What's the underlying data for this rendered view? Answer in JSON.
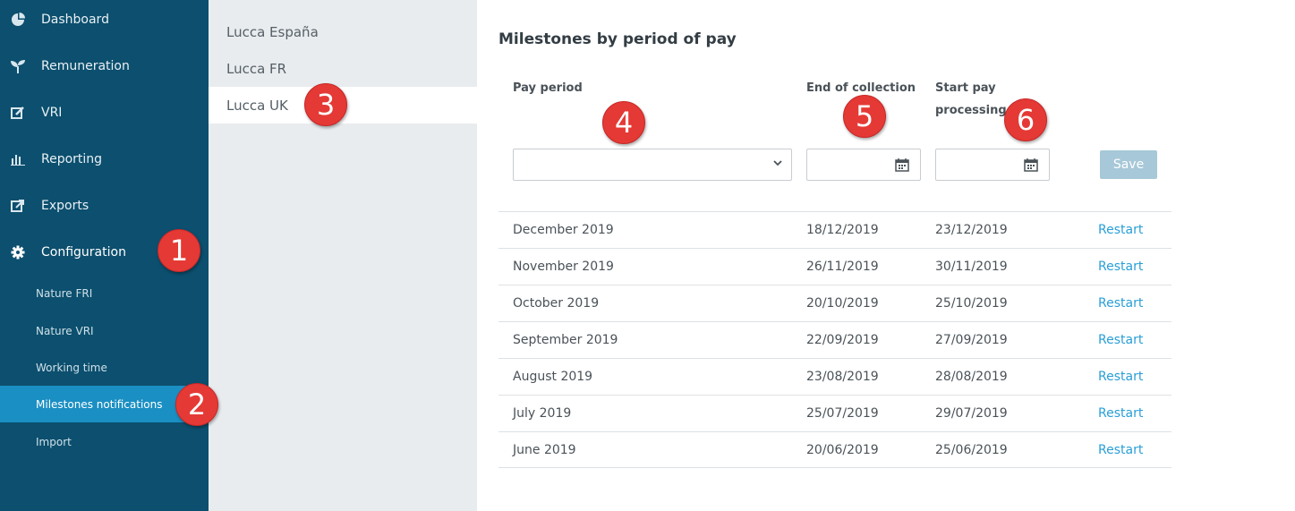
{
  "sidebar": {
    "items": [
      {
        "label": "Dashboard",
        "icon": "pie-chart-icon"
      },
      {
        "label": "Remuneration",
        "icon": "sprout-icon"
      },
      {
        "label": "VRI",
        "icon": "edit-icon"
      },
      {
        "label": "Reporting",
        "icon": "bar-chart-icon"
      },
      {
        "label": "Exports",
        "icon": "export-icon"
      },
      {
        "label": "Configuration",
        "icon": "gear-icon"
      }
    ],
    "sub_items": [
      {
        "label": "Nature FRI"
      },
      {
        "label": "Nature VRI"
      },
      {
        "label": "Working time"
      },
      {
        "label": "Milestones notifications"
      },
      {
        "label": "Import"
      }
    ]
  },
  "companies": [
    {
      "label": "Lucca España"
    },
    {
      "label": "Lucca FR"
    },
    {
      "label": "Lucca UK"
    }
  ],
  "main": {
    "title": "Milestones by period of pay",
    "headers": {
      "pay_period": "Pay period",
      "end_collection": "End of collection",
      "start_pay_line1": "Start pay",
      "start_pay_line2": "processing"
    },
    "inputs": {
      "pay_period_value": "",
      "end_collection_value": "",
      "start_pay_value": ""
    },
    "save_label": "Save",
    "rows": [
      {
        "period": "December 2019",
        "end": "18/12/2019",
        "start": "23/12/2019",
        "action": "Restart"
      },
      {
        "period": "November 2019",
        "end": "26/11/2019",
        "start": "30/11/2019",
        "action": "Restart"
      },
      {
        "period": "October 2019",
        "end": "20/10/2019",
        "start": "25/10/2019",
        "action": "Restart"
      },
      {
        "period": "September 2019",
        "end": "22/09/2019",
        "start": "27/09/2019",
        "action": "Restart"
      },
      {
        "period": "August 2019",
        "end": "23/08/2019",
        "start": "28/08/2019",
        "action": "Restart"
      },
      {
        "period": "July 2019",
        "end": "25/07/2019",
        "start": "29/07/2019",
        "action": "Restart"
      },
      {
        "period": "June 2019",
        "end": "20/06/2019",
        "start": "25/06/2019",
        "action": "Restart"
      }
    ]
  },
  "callouts": [
    "1",
    "2",
    "3",
    "4",
    "5",
    "6"
  ],
  "colors": {
    "sidebar_bg": "#0c4f6e",
    "sidebar_active": "#1a8fc3",
    "link": "#2a9fd6",
    "callout": "#e53935",
    "save_disabled": "#a7c8d8"
  }
}
